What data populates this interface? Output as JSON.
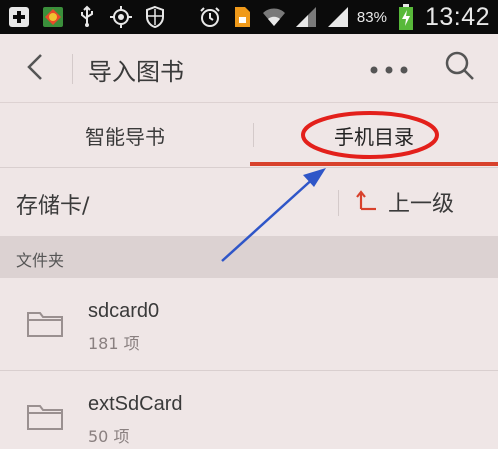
{
  "status_bar": {
    "battery_percent": "83%",
    "time": "13:42",
    "icons": [
      "add-icon",
      "app-icon",
      "usb-icon",
      "gps-icon",
      "shield-icon",
      "alarm-icon",
      "sim-card-icon",
      "wifi-icon",
      "signal-icon",
      "signal-icon",
      "battery-charging-icon"
    ]
  },
  "app_bar": {
    "title": "导入图书",
    "icons": [
      "back-icon",
      "more-icon",
      "search-icon"
    ]
  },
  "tabs": [
    {
      "label": "智能导书",
      "active": false
    },
    {
      "label": "手机目录",
      "active": true
    }
  ],
  "path_bar": {
    "path": "存储卡/",
    "up_label": "上一级"
  },
  "section": {
    "title": "文件夹"
  },
  "folders": [
    {
      "name": "sdcard0",
      "count": "181 项"
    },
    {
      "name": "extSdCard",
      "count": "50 项"
    }
  ],
  "colors": {
    "accent": "#d8412c",
    "annotation_circle": "#e3201b",
    "annotation_arrow": "#2f56c8",
    "background": "#efe6e6",
    "status_bar": "#0b0b0b"
  }
}
